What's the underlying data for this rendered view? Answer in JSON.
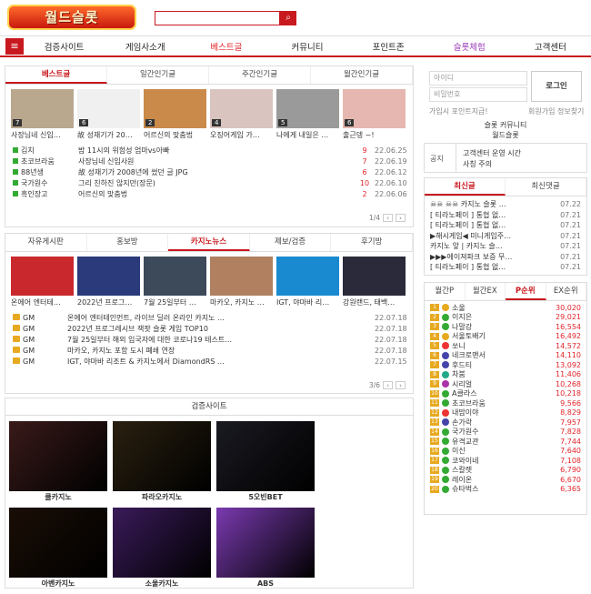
{
  "site": {
    "logo_text": "월드슬롯"
  },
  "search": {
    "placeholder": ""
  },
  "nav": {
    "items": [
      "검증사이트",
      "게임사소개",
      "베스트글",
      "커뮤니티",
      "포인트존",
      "슬롯체험",
      "고객센터"
    ],
    "active": 2,
    "special": 5
  },
  "best": {
    "tabs": [
      "베스트글",
      "일간인기글",
      "주간인기글",
      "월간인기글"
    ],
    "thumbs": [
      {
        "badge": "7",
        "caption": "사장님네 신입…",
        "color": "#b9a78e"
      },
      {
        "badge": "6",
        "caption": "故 성재기가 20…",
        "color": "#f0f0f0"
      },
      {
        "badge": "2",
        "caption": "어르신의 맞춤법",
        "color": "#c98a4a"
      },
      {
        "badge": "4",
        "caption": "오징어게임 가…",
        "color": "#d9c4c0"
      },
      {
        "badge": "5",
        "caption": "나에게 내일은 …",
        "color": "#9a9a9a"
      },
      {
        "badge": "6",
        "caption": "출근뎅 ~!",
        "color": "#e5b7b0"
      }
    ],
    "rows": [
      {
        "cat": "김치",
        "title": "밤 11시의 위험성 엄마vs아빠",
        "cnt": "9",
        "date": "22.06.25"
      },
      {
        "cat": "초코브라움",
        "title": "사장님네 신입사원",
        "cnt": "7",
        "date": "22.06.19"
      },
      {
        "cat": "88년생",
        "title": "故 성재기가 2008년에 썼던 글 JPG",
        "cnt": "6",
        "date": "22.06.12"
      },
      {
        "cat": "국가원수",
        "title": "그리 친하진 않지만(장문)",
        "cnt": "10",
        "date": "22.06.10"
      },
      {
        "cat": "흑인장고",
        "title": "어르신의 맞춤법",
        "cnt": "2",
        "date": "22.06.06"
      }
    ],
    "page": "1/4"
  },
  "news": {
    "tabs": [
      "자유게시판",
      "홍보방",
      "카지노뉴스",
      "제보/검증",
      "후기방"
    ],
    "thumbs": [
      {
        "caption": "온에어 엔터테…",
        "color": "#c9282d"
      },
      {
        "caption": "2022년 프로그…",
        "color": "#2a3a7a"
      },
      {
        "caption": "7월 25일부터 …",
        "color": "#3c4a5a"
      },
      {
        "caption": "마카오, 카지노 …",
        "color": "#b08060"
      },
      {
        "caption": "IGT, 야마바 리…",
        "color": "#1a8ad0"
      },
      {
        "caption": "강원랜드, 태백…",
        "color": "#2a2a3a"
      }
    ],
    "rows": [
      {
        "cat": "GM",
        "title": "온에어 엔터테인먼트, 라이브 딜러 온라인 카지노 …",
        "date": "22.07.18"
      },
      {
        "cat": "GM",
        "title": "2022년 프로그레시브 잭팟 슬롯 게임 TOP10",
        "date": "22.07.18"
      },
      {
        "cat": "GM",
        "title": "7월 25일부터 해외 입국자에 대한 코로나19 테스트…",
        "date": "22.07.18"
      },
      {
        "cat": "GM",
        "title": "마카오, 카지노 포함 도시 폐쇄 연장",
        "date": "22.07.18"
      },
      {
        "cat": "GM",
        "title": "IGT, 야마바 리조트 & 카지노에서 DiamondRS …",
        "date": "22.07.15"
      }
    ],
    "page": "3/6"
  },
  "verified": {
    "title": "검증사이트",
    "sites": [
      {
        "name": "쿨카지노",
        "color": "#3a1a1a"
      },
      {
        "name": "파라오카지노",
        "color": "#2a2010"
      },
      {
        "name": "5오빈BET",
        "color": "#1a1a22"
      },
      {
        "name": "아벤카지노",
        "color": "#1a0e06"
      },
      {
        "name": "소울카지노",
        "color": "#3a1a5a"
      },
      {
        "name": "ABS",
        "color": "#7a3ab0"
      }
    ]
  },
  "login": {
    "id_placeholder": "아이디",
    "pw_placeholder": "비밀번호",
    "button": "로그인",
    "link_left": "가입시 포인트지급!",
    "link_right": "회원가입 정보찾기",
    "community": "슬롯 커뮤니티",
    "brand": "월드슬롯"
  },
  "notice": {
    "label": "공지",
    "lines": [
      "고객센터 운영 시간",
      "사칭 주의"
    ]
  },
  "latest": {
    "tabs": [
      "최신글",
      "최신댓글"
    ],
    "rows": [
      {
        "t": "☠☠ ☠☠ 카지노 슬롯 …",
        "d": "07.22"
      },
      {
        "t": "[ 티라노페이 ] 통협 없…",
        "d": "07.21"
      },
      {
        "t": "[ 티라노페이 ] 통협 없…",
        "d": "07.21"
      },
      {
        "t": "▶해시게임◀ 미니게임주…",
        "d": "07.21"
      },
      {
        "t": "카지노 앞 | 카지노 슬…",
        "d": "07.21"
      },
      {
        "t": "▶▶▶에이져파크 보증 무…",
        "d": "07.21"
      },
      {
        "t": "[ 티라노페이 ] 통협 없…",
        "d": "07.21"
      }
    ]
  },
  "ranking": {
    "tabs": [
      "월간P",
      "월간EX",
      "P순위",
      "EX순위"
    ],
    "active": 2,
    "rows": [
      {
        "n": "1",
        "name": "소울",
        "pt": "30,020",
        "ic": "#e7a91f"
      },
      {
        "n": "2",
        "name": "이지은",
        "pt": "29,021",
        "ic": "#3a3"
      },
      {
        "n": "3",
        "name": "나말강",
        "pt": "16,554",
        "ic": "#3a3"
      },
      {
        "n": "4",
        "name": "서울토배기",
        "pt": "16,492",
        "ic": "#e7a91f"
      },
      {
        "n": "5",
        "name": "쏘니",
        "pt": "14,572",
        "ic": "#e33"
      },
      {
        "n": "6",
        "name": "네크로맨서",
        "pt": "14,110",
        "ic": "#44a"
      },
      {
        "n": "7",
        "name": "후드티",
        "pt": "13,092",
        "ic": "#44a"
      },
      {
        "n": "8",
        "name": "차붐",
        "pt": "11,406",
        "ic": "#2a8"
      },
      {
        "n": "9",
        "name": "시리얼",
        "pt": "10,268",
        "ic": "#a3a"
      },
      {
        "n": "10",
        "name": "A클라스",
        "pt": "10,218",
        "ic": "#3a3"
      },
      {
        "n": "11",
        "name": "초코브라움",
        "pt": "9,566",
        "ic": "#3a3"
      },
      {
        "n": "12",
        "name": "내맘이야",
        "pt": "8,829",
        "ic": "#e33"
      },
      {
        "n": "13",
        "name": "손가락",
        "pt": "7,957",
        "ic": "#44a"
      },
      {
        "n": "14",
        "name": "국가원수",
        "pt": "7,828",
        "ic": "#3a3"
      },
      {
        "n": "15",
        "name": "유격교관",
        "pt": "7,744",
        "ic": "#3a3"
      },
      {
        "n": "16",
        "name": "이신",
        "pt": "7,640",
        "ic": "#3a3"
      },
      {
        "n": "17",
        "name": "코와이네",
        "pt": "7,108",
        "ic": "#3a3"
      },
      {
        "n": "18",
        "name": "스칼렛",
        "pt": "6,790",
        "ic": "#3a3"
      },
      {
        "n": "19",
        "name": "레이온",
        "pt": "6,670",
        "ic": "#3a3"
      },
      {
        "n": "20",
        "name": "슈타벅스",
        "pt": "6,365",
        "ic": "#3a3"
      }
    ]
  }
}
